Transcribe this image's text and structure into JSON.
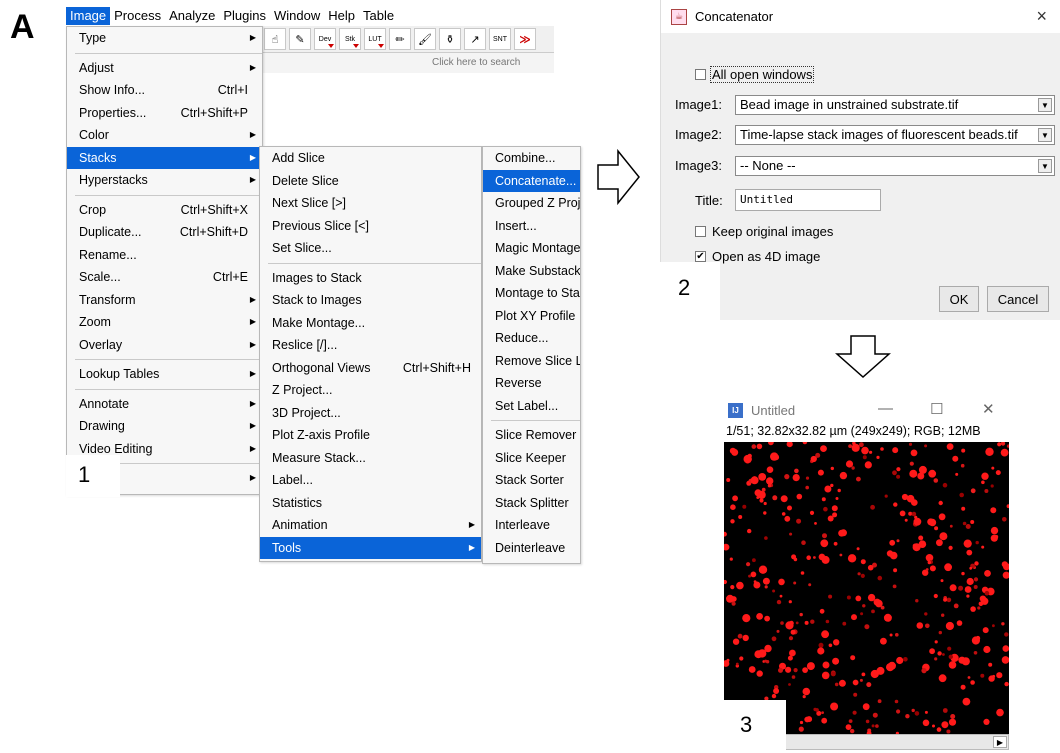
{
  "panel_label": "A",
  "step_labels": [
    "1",
    "2",
    "3"
  ],
  "menubar": {
    "items": [
      "Image",
      "Process",
      "Analyze",
      "Plugins",
      "Window",
      "Help",
      "Table"
    ],
    "active": "Image"
  },
  "toolbar": {
    "buttons": [
      "Dev",
      "Stk",
      "LUT",
      "SNT",
      "≫"
    ],
    "search_placeholder": "Click here to search"
  },
  "image_menu": {
    "items": [
      {
        "label": "Type",
        "submenu": true
      },
      {
        "sep": true
      },
      {
        "label": "Adjust",
        "submenu": true
      },
      {
        "label": "Show Info...",
        "shortcut": "Ctrl+I"
      },
      {
        "label": "Properties...",
        "shortcut": "Ctrl+Shift+P"
      },
      {
        "label": "Color",
        "submenu": true
      },
      {
        "label": "Stacks",
        "submenu": true,
        "selected": true
      },
      {
        "label": "Hyperstacks",
        "submenu": true
      },
      {
        "sep": true
      },
      {
        "label": "Crop",
        "shortcut": "Ctrl+Shift+X"
      },
      {
        "label": "Duplicate...",
        "shortcut": "Ctrl+Shift+D"
      },
      {
        "label": "Rename..."
      },
      {
        "label": "Scale...",
        "shortcut": "Ctrl+E"
      },
      {
        "label": "Transform",
        "submenu": true
      },
      {
        "label": "Zoom",
        "submenu": true
      },
      {
        "label": "Overlay",
        "submenu": true
      },
      {
        "sep": true
      },
      {
        "label": "Lookup Tables",
        "submenu": true
      },
      {
        "sep": true
      },
      {
        "label": "Annotate",
        "submenu": true
      },
      {
        "label": "Drawing",
        "submenu": true
      },
      {
        "label": "Video Editing",
        "submenu": true
      },
      {
        "sep": true
      },
      {
        "label": "",
        "submenu": true
      }
    ]
  },
  "stacks_menu": {
    "items": [
      {
        "label": "Add Slice"
      },
      {
        "label": "Delete Slice"
      },
      {
        "label": "Next Slice [>]"
      },
      {
        "label": "Previous Slice [<]"
      },
      {
        "label": "Set Slice..."
      },
      {
        "sep": true
      },
      {
        "label": "Images to Stack"
      },
      {
        "label": "Stack to Images"
      },
      {
        "label": "Make Montage..."
      },
      {
        "label": "Reslice [/]..."
      },
      {
        "label": "Orthogonal Views",
        "shortcut": "Ctrl+Shift+H"
      },
      {
        "label": "Z Project..."
      },
      {
        "label": "3D Project..."
      },
      {
        "label": "Plot Z-axis Profile"
      },
      {
        "label": "Measure Stack..."
      },
      {
        "label": "Label..."
      },
      {
        "label": "Statistics"
      },
      {
        "label": "Animation",
        "submenu": true
      },
      {
        "label": "Tools",
        "submenu": true,
        "selected": true
      }
    ]
  },
  "tools_menu": {
    "items": [
      {
        "label": "Combine..."
      },
      {
        "label": "Concatenate...",
        "selected": true
      },
      {
        "label": "Grouped Z Proje"
      },
      {
        "label": "Insert..."
      },
      {
        "label": "Magic Montage"
      },
      {
        "label": "Make Substack"
      },
      {
        "label": "Montage to Stac"
      },
      {
        "label": "Plot XY Profile"
      },
      {
        "label": "Reduce..."
      },
      {
        "label": "Remove Slice L"
      },
      {
        "label": "Reverse"
      },
      {
        "label": "Set Label..."
      },
      {
        "sep": true
      },
      {
        "label": "Slice Remover"
      },
      {
        "label": "Slice Keeper"
      },
      {
        "label": "Stack Sorter"
      },
      {
        "label": "Stack Splitter"
      },
      {
        "label": "Interleave"
      },
      {
        "label": "Deinterleave"
      }
    ]
  },
  "dialog": {
    "title": "Concatenator",
    "close": "×",
    "all_open_windows": {
      "label": "All open windows",
      "checked": false
    },
    "image1": {
      "label": "Image1:",
      "value": "Bead image in unstrained substrate.tif"
    },
    "image2": {
      "label": "Image2:",
      "value": "Time-lapse stack images of fluorescent beads.tif"
    },
    "image3": {
      "label": "Image3:",
      "value": "-- None --"
    },
    "title_field": {
      "label": "Title:",
      "value": "Untitled"
    },
    "keep_original": {
      "label": "Keep original images",
      "checked": false
    },
    "open_4d": {
      "label": "Open as 4D image",
      "checked": true
    },
    "ok": "OK",
    "cancel": "Cancel"
  },
  "image_window": {
    "title": "Untitled",
    "info": "1/51; 32.82x32.82 µm (249x249); RGB; 12MB",
    "controls": [
      "—",
      "☐",
      "✕"
    ]
  },
  "colors": {
    "accent": "#0a64d8",
    "bead": "#ff1a1a"
  }
}
